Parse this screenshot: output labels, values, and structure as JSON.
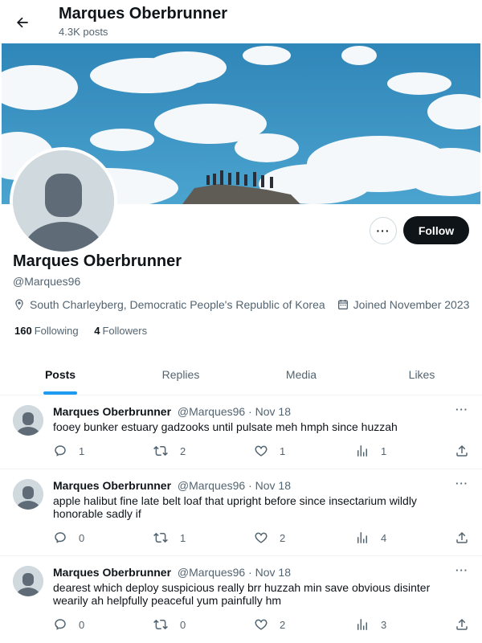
{
  "header": {
    "name": "Marques Oberbrunner",
    "post_count": "4.3K posts"
  },
  "profile": {
    "name": "Marques Oberbrunner",
    "handle": "@Marques96",
    "location": "South Charleyberg, Democratic People's Republic of Korea",
    "joined": "Joined November 2023",
    "following_count": "160",
    "following_label": "Following",
    "followers_count": "4",
    "followers_label": "Followers",
    "follow_label": "Follow",
    "more_label": "···"
  },
  "tabs": [
    {
      "label": "Posts",
      "active": true
    },
    {
      "label": "Replies",
      "active": false
    },
    {
      "label": "Media",
      "active": false
    },
    {
      "label": "Likes",
      "active": false
    }
  ],
  "posts": [
    {
      "name": "Marques Oberbrunner",
      "handle": "@Marques96",
      "dot": "·",
      "date": "Nov 18",
      "text": "fooey bunker estuary gadzooks until pulsate meh hmph since huzzah",
      "replies": "1",
      "reposts": "2",
      "likes": "1",
      "views": "1"
    },
    {
      "name": "Marques Oberbrunner",
      "handle": "@Marques96",
      "dot": "·",
      "date": "Nov 18",
      "text": "apple halibut fine late belt loaf that upright before since insectarium wildly honorable sadly if",
      "replies": "0",
      "reposts": "1",
      "likes": "2",
      "views": "4"
    },
    {
      "name": "Marques Oberbrunner",
      "handle": "@Marques96",
      "dot": "·",
      "date": "Nov 18",
      "text": "dearest which deploy suspicious really brr huzzah min save obvious disinter wearily ah helpfully peaceful yum painfully hm",
      "replies": "0",
      "reposts": "0",
      "likes": "2",
      "views": "3"
    }
  ],
  "post_more_label": "···",
  "icons": {
    "back": "arrow-left-icon",
    "location": "location-pin-icon",
    "calendar": "calendar-icon",
    "reply": "reply-icon",
    "repost": "repost-icon",
    "like": "heart-icon",
    "views": "views-icon",
    "share": "share-icon"
  },
  "colors": {
    "accent": "#1d9bf0",
    "text": "#0f1419",
    "muted": "#536471",
    "follow_bg": "#0f1419"
  }
}
